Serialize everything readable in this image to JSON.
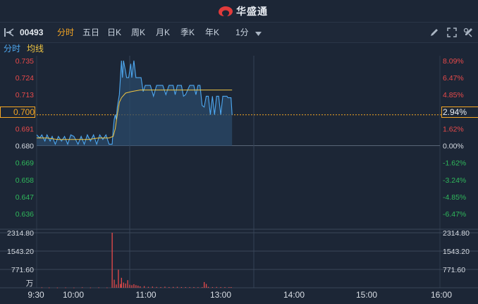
{
  "brand": {
    "name": "华盛通",
    "icon": "huasheng-logo-icon",
    "accent": "#e23b3b"
  },
  "toolbar": {
    "sidebar_toggle_icon": "sidebar-toggle-icon",
    "stock_code": "00493",
    "tabs": [
      "分时",
      "五日",
      "日K",
      "周K",
      "月K",
      "季K",
      "年K"
    ],
    "active_tab": "分时",
    "interval": "1分",
    "tools": [
      "draw-pencil-icon",
      "expand-icon",
      "settings-icon"
    ]
  },
  "subbar": {
    "mode": "分时",
    "avg_line": "均线"
  },
  "colors": {
    "up": "#e84a4a",
    "down": "#2fb85b",
    "neutral": "#d6dbe2",
    "price_line": "#4ea8f0",
    "avg_line": "#f0c541",
    "highlight": "#f5a623"
  },
  "chart_data": {
    "type": "line",
    "title": "",
    "prev_close": 0.68,
    "price_ticks": [
      "0.735",
      "0.724",
      "0.713",
      "0.702",
      "0.691",
      "0.680",
      "0.669",
      "0.658",
      "0.647",
      "0.636"
    ],
    "pct_ticks": [
      "8.09%",
      "6.47%",
      "4.85%",
      "3.24%",
      "1.62%",
      "0.00%",
      "-1.62%",
      "-3.24%",
      "-4.85%",
      "-6.47%"
    ],
    "current_price": "0.700",
    "current_pct": "2.94%",
    "x_ticks": [
      "9:30",
      "10:00",
      "11:00",
      "13:00",
      "14:00",
      "15:00",
      "16:00"
    ],
    "price_series": {
      "name": "分时",
      "points": [
        [
          0,
          0.687
        ],
        [
          3,
          0.685
        ],
        [
          5,
          0.687
        ],
        [
          8,
          0.683
        ],
        [
          10,
          0.687
        ],
        [
          13,
          0.683
        ],
        [
          15,
          0.686
        ],
        [
          18,
          0.681
        ],
        [
          21,
          0.686
        ],
        [
          24,
          0.683
        ],
        [
          27,
          0.686
        ],
        [
          30,
          0.681
        ],
        [
          33,
          0.687
        ],
        [
          36,
          0.686
        ],
        [
          40,
          0.681
        ],
        [
          43,
          0.686
        ],
        [
          46,
          0.681
        ],
        [
          49,
          0.687
        ],
        [
          52,
          0.683
        ],
        [
          55,
          0.687
        ],
        [
          58,
          0.681
        ],
        [
          61,
          0.687
        ],
        [
          64,
          0.684
        ],
        [
          67,
          0.687
        ],
        [
          70,
          0.681
        ],
        [
          73,
          0.681
        ],
        [
          74,
          0.69
        ],
        [
          75,
          0.697
        ],
        [
          76,
          0.7
        ],
        [
          77,
          0.697
        ],
        [
          78,
          0.705
        ],
        [
          80,
          0.713
        ],
        [
          81,
          0.724
        ],
        [
          82,
          0.735
        ],
        [
          83,
          0.724
        ],
        [
          84,
          0.735
        ],
        [
          86,
          0.728
        ],
        [
          87,
          0.724
        ],
        [
          89,
          0.724
        ],
        [
          91,
          0.733
        ],
        [
          92,
          0.724
        ],
        [
          94,
          0.735
        ],
        [
          96,
          0.724
        ],
        [
          98,
          0.724
        ],
        [
          101,
          0.724
        ],
        [
          103,
          0.715
        ],
        [
          105,
          0.719
        ],
        [
          110,
          0.719
        ],
        [
          113,
          0.712
        ],
        [
          116,
          0.719
        ],
        [
          122,
          0.719
        ],
        [
          125,
          0.713
        ],
        [
          128,
          0.719
        ],
        [
          132,
          0.719
        ],
        [
          134,
          0.713
        ],
        [
          136,
          0.719
        ],
        [
          140,
          0.719
        ],
        [
          142,
          0.712
        ],
        [
          144,
          0.713
        ],
        [
          148,
          0.719
        ],
        [
          152,
          0.719
        ],
        [
          154,
          0.713
        ],
        [
          156,
          0.719
        ],
        [
          158,
          0.719
        ],
        [
          160,
          0.706
        ],
        [
          162,
          0.705
        ],
        [
          164,
          0.712
        ],
        [
          166,
          0.712
        ],
        [
          168,
          0.7
        ],
        [
          170,
          0.712
        ],
        [
          172,
          0.7
        ],
        [
          174,
          0.712
        ],
        [
          176,
          0.712
        ],
        [
          178,
          0.7
        ],
        [
          180,
          0.712
        ],
        [
          184,
          0.712
        ],
        [
          185,
          0.711
        ],
        [
          188,
          0.711
        ],
        [
          189,
          0.7
        ]
      ]
    },
    "avg_series": {
      "name": "均线",
      "points": [
        [
          0,
          0.685
        ],
        [
          10,
          0.685
        ],
        [
          20,
          0.684
        ],
        [
          30,
          0.684
        ],
        [
          40,
          0.684
        ],
        [
          50,
          0.684
        ],
        [
          60,
          0.685
        ],
        [
          70,
          0.685
        ],
        [
          74,
          0.686
        ],
        [
          76,
          0.691
        ],
        [
          78,
          0.7
        ],
        [
          80,
          0.708
        ],
        [
          82,
          0.711
        ],
        [
          86,
          0.714
        ],
        [
          92,
          0.715
        ],
        [
          100,
          0.716
        ],
        [
          110,
          0.716
        ],
        [
          130,
          0.716
        ],
        [
          150,
          0.716
        ],
        [
          170,
          0.716
        ],
        [
          189,
          0.716
        ]
      ]
    },
    "volume": {
      "unit": "万",
      "ticks": [
        "2314.80",
        "1543.20",
        "771.60"
      ],
      "bars": [
        [
          5,
          18
        ],
        [
          12,
          12
        ],
        [
          20,
          10
        ],
        [
          28,
          14
        ],
        [
          36,
          9
        ],
        [
          44,
          20
        ],
        [
          52,
          11
        ],
        [
          60,
          16
        ],
        [
          68,
          13
        ],
        [
          73,
          2314.8
        ],
        [
          75,
          340
        ],
        [
          77,
          140
        ],
        [
          79,
          760
        ],
        [
          81,
          160
        ],
        [
          82,
          420
        ],
        [
          84,
          220
        ],
        [
          86,
          180
        ],
        [
          88,
          320
        ],
        [
          90,
          130
        ],
        [
          92,
          110
        ],
        [
          94,
          150
        ],
        [
          96,
          110
        ],
        [
          98,
          90
        ],
        [
          100,
          60
        ],
        [
          104,
          70
        ],
        [
          108,
          40
        ],
        [
          112,
          50
        ],
        [
          116,
          35
        ],
        [
          120,
          30
        ],
        [
          124,
          45
        ],
        [
          128,
          30
        ],
        [
          132,
          35
        ],
        [
          136,
          40
        ],
        [
          140,
          30
        ],
        [
          144,
          30
        ],
        [
          148,
          28
        ],
        [
          152,
          30
        ],
        [
          156,
          25
        ],
        [
          160,
          28
        ],
        [
          162,
          240
        ],
        [
          164,
          160
        ],
        [
          166,
          40
        ],
        [
          170,
          30
        ],
        [
          174,
          35
        ],
        [
          178,
          30
        ],
        [
          182,
          30
        ],
        [
          186,
          28
        ],
        [
          188,
          30
        ]
      ]
    }
  }
}
